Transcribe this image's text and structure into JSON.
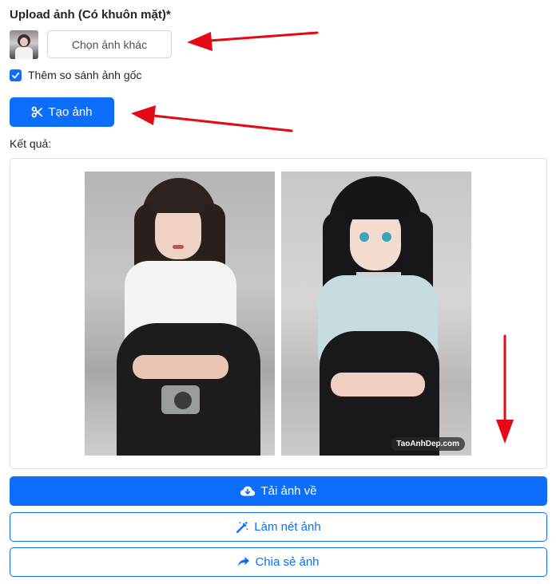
{
  "upload": {
    "label": "Upload ảnh (Có khuôn mặt)*",
    "choose_button": "Chọn ảnh khác"
  },
  "options": {
    "compare_label": "Thêm so sánh ảnh gốc",
    "compare_checked": true
  },
  "create_button": {
    "label": "Tạo ảnh",
    "icon": "scissors-icon"
  },
  "result": {
    "label": "Kết quả:",
    "watermark": "TaoAnhDep.com"
  },
  "actions": {
    "download_label": "Tải ảnh về",
    "download_icon": "cloud-download-icon",
    "sharpen_label": "Làm nét ảnh",
    "sharpen_icon": "magic-wand-icon",
    "share_label": "Chia sẻ ảnh",
    "share_icon": "share-arrow-icon"
  },
  "colors": {
    "primary": "#0d6efd",
    "annotation_arrow": "#e50914"
  }
}
